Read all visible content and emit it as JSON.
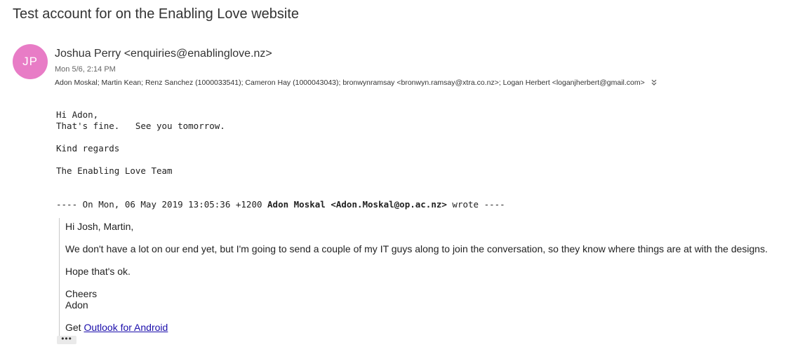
{
  "email": {
    "subject": "Test account for on the Enabling Love website",
    "avatar_initials": "JP",
    "avatar_color": "#e87cc6",
    "sender": "Joshua Perry <enquiries@enablinglove.nz>",
    "date": "Mon 5/6, 2:14 PM",
    "recipients": "Adon Moskal; Martin Kean; Renz Sanchez (1000033541); Cameron Hay (1000043043); bronwynramsay <bronwyn.ramsay@xtra.co.nz>; Logan Herbert <loganjherbert@gmail.com>",
    "expand_icon": "double-chevron-down-icon"
  },
  "reply": {
    "greeting": "Hi Adon,",
    "line1": "That's fine.   See you tomorrow.",
    "signoff": "Kind regards",
    "team": "The Enabling Love Team"
  },
  "quote_header": {
    "prefix": "---- On Mon, 06 May 2019 13:05:36 +1200 ",
    "author": "Adon Moskal <Adon.Moskal@op.ac.nz>",
    "suffix": " wrote ----"
  },
  "quoted": {
    "greeting": "Hi Josh, Martin,",
    "paragraph": "We don't have a lot on our end yet, but I'm going to send a couple of my IT guys along to join the conversation, so they know where things are at with the designs.",
    "hope": "Hope that's ok.",
    "cheers": "Cheers",
    "name": "Adon",
    "get_prefix": "Get ",
    "get_link": "Outlook for Android"
  },
  "more_button": {
    "label": "•••",
    "icon": "ellipsis-icon"
  },
  "colors": {
    "link": "#1a0dab",
    "quote_border": "#c8c8c8"
  }
}
